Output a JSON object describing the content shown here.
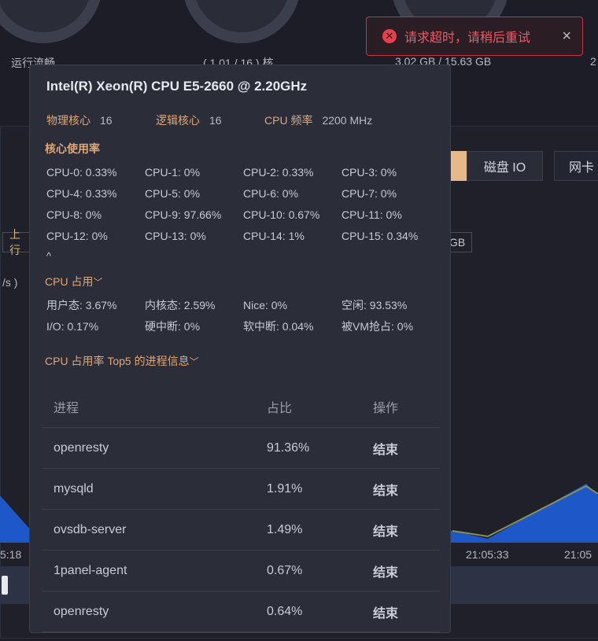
{
  "toast": {
    "message": "请求超时，请稍后重试",
    "close_symbol": "×"
  },
  "background": {
    "status_label": "运行流畅",
    "load_value": "( 1.01 / 16 ) 核",
    "memory_value": "3.02 GB / 15.63 GB",
    "partial_right": "2",
    "tab_disk": "磁盘 IO",
    "tab_network": "网卡",
    "tag_upstream": "上行",
    "tag_unit": "GB",
    "y_unit": "/s )",
    "x_ticks": [
      "5:18",
      "21:05:33",
      "21:05"
    ]
  },
  "cpu_popover": {
    "model": "Intel(R) Xeon(R) CPU E5-2660 @ 2.20GHz",
    "physical_cores_label": "物理核心",
    "physical_cores": "16",
    "logical_cores_label": "逻辑核心",
    "logical_cores": "16",
    "freq_label": "CPU 频率",
    "freq": "2200 MHz",
    "core_usage_title": "核心使用率",
    "cores": [
      "CPU-0: 0.33%",
      "CPU-1: 0%",
      "CPU-2: 0.33%",
      "CPU-3: 0%",
      "CPU-4: 0.33%",
      "CPU-5: 0%",
      "CPU-6: 0%",
      "CPU-7: 0%",
      "CPU-8: 0%",
      "CPU-9: 97.66%",
      "CPU-10: 0.67%",
      "CPU-11: 0%",
      "CPU-12: 0%",
      "CPU-13: 0%",
      "CPU-14: 1%",
      "CPU-15: 0.34%"
    ],
    "collapse_symbol": "^",
    "cpu_usage_title": "CPU 占用",
    "usage": [
      "用户态: 3.67%",
      "内核态: 2.59%",
      "Nice: 0%",
      "空闲: 93.53%",
      "I/O: 0.17%",
      "硬中断: 0%",
      "软中断: 0.04%",
      "被VM抢占: 0%"
    ],
    "top5_title": "CPU 占用率 Top5 的进程信息",
    "table_headers": [
      "进程",
      "占比",
      "操作"
    ],
    "processes": [
      {
        "name": "openresty",
        "pct": "91.36%",
        "action": "结束"
      },
      {
        "name": "mysqld",
        "pct": "1.91%",
        "action": "结束"
      },
      {
        "name": "ovsdb-server",
        "pct": "1.49%",
        "action": "结束"
      },
      {
        "name": "1panel-agent",
        "pct": "0.67%",
        "action": "结束"
      },
      {
        "name": "openresty",
        "pct": "0.64%",
        "action": "结束"
      }
    ]
  }
}
